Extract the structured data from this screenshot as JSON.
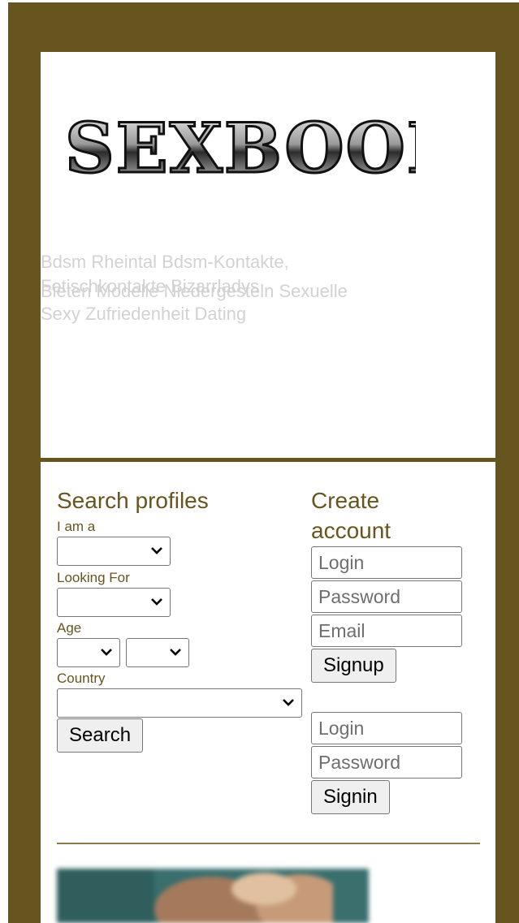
{
  "logo": {
    "alt_text": "SEXBOOK"
  },
  "tagline": {
    "line1": "Bdsm Rheintal Bdsm-Kontakte,",
    "line2a": "Fetischkontakte Bizarrladys",
    "line2b": "Bieten Modelle Niedergesteln Sexuelle",
    "line3": "Sexy Zufriedenheit Dating"
  },
  "search": {
    "heading": "Search profiles",
    "i_am_label": "I am a",
    "looking_for_label": "Looking For",
    "age_label": "Age",
    "country_label": "Country",
    "search_button": "Search"
  },
  "signup": {
    "heading_line1": "Create",
    "heading_line2": "account",
    "login_placeholder": "Login",
    "password_placeholder": "Password",
    "email_placeholder": "Email",
    "signup_button": "Signup"
  },
  "signin": {
    "login_placeholder": "Login",
    "password_placeholder": "Password",
    "signin_button": "Signin"
  },
  "colors": {
    "frame": "#675520",
    "accent_text": "#675520",
    "tagline": "#d2d2d2"
  }
}
